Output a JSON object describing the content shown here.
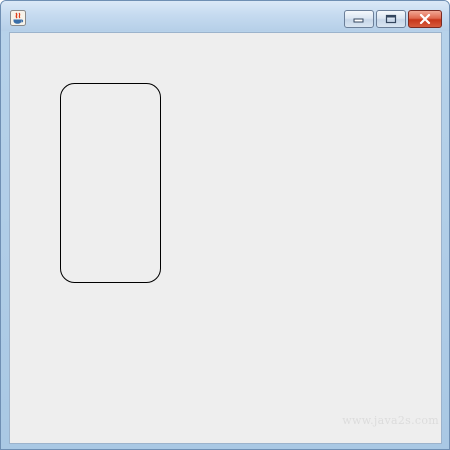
{
  "window": {
    "title": "",
    "controls": {
      "minimize_icon": "minimize-icon",
      "maximize_icon": "maximize-icon",
      "close_icon": "close-icon"
    },
    "colors": {
      "client_background": "#eeeeee",
      "shape_stroke": "#000000",
      "close_button": "#c7361b"
    }
  },
  "canvas": {
    "shape": "rounded-rectangle",
    "watermark": "www.java2s.com"
  }
}
